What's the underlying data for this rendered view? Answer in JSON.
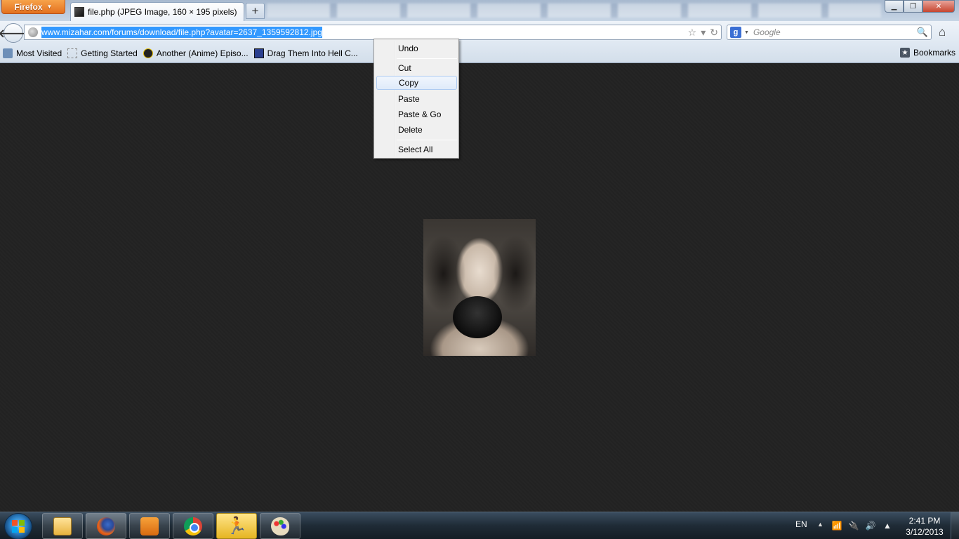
{
  "browser": {
    "menu_button_label": "Firefox",
    "tab_title": "file.php (JPEG Image, 160 × 195 pixels)",
    "new_tab_label": "+"
  },
  "navbar": {
    "url": "www.mizahar.com/forums/download/file.php?avatar=2637_1359592812.jpg",
    "search_engine_icon": "google-icon",
    "search_placeholder": "Google"
  },
  "bookmarks": {
    "items": [
      {
        "label": "Most Visited",
        "icon": "most-visited-icon"
      },
      {
        "label": "Getting Started",
        "icon": "getting-started-icon"
      },
      {
        "label": "Another (Anime) Episo...",
        "icon": "anime-icon"
      },
      {
        "label": "Drag Them Into Hell C...",
        "icon": "drag-icon"
      }
    ],
    "right_label": "Bookmarks"
  },
  "context_menu": {
    "items": [
      {
        "label": "Undo",
        "highlighted": false
      },
      {
        "label": "Cut",
        "highlighted": false
      },
      {
        "label": "Copy",
        "highlighted": true
      },
      {
        "label": "Paste",
        "highlighted": false
      },
      {
        "label": "Paste & Go",
        "highlighted": false
      },
      {
        "label": "Delete",
        "highlighted": false
      },
      {
        "label": "Select All",
        "highlighted": false
      }
    ]
  },
  "taskbar": {
    "apps": [
      {
        "name": "explorer",
        "icon": "folder-icon"
      },
      {
        "name": "firefox",
        "icon": "firefox-icon"
      },
      {
        "name": "media-player",
        "icon": "media-player-icon"
      },
      {
        "name": "chrome",
        "icon": "chrome-icon"
      },
      {
        "name": "aim",
        "icon": "aim-icon"
      },
      {
        "name": "paint",
        "icon": "paint-icon"
      }
    ],
    "language": "EN",
    "time": "2:41 PM",
    "date": "3/12/2013"
  },
  "colors": {
    "url_selection": "#3399ff",
    "firefox_button": "#e4711f",
    "content_background": "#222222"
  }
}
